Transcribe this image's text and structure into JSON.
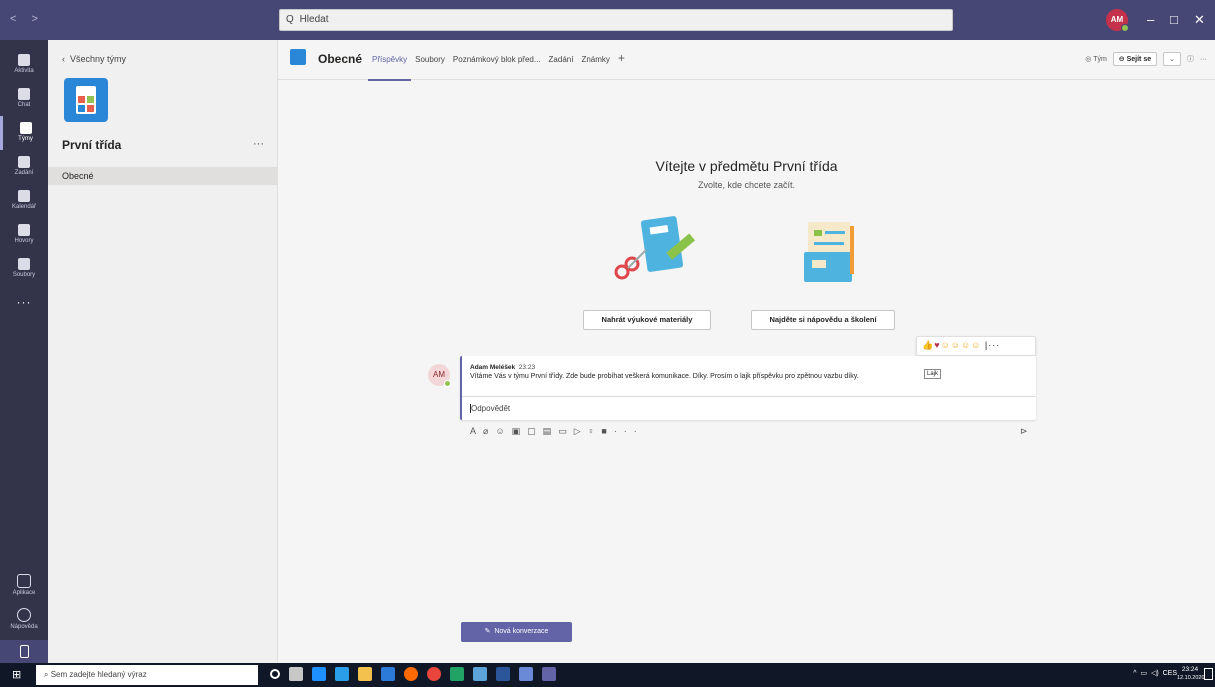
{
  "titlebar": {
    "search_text": "Hledat",
    "user_initials": "AM",
    "minimize": "–",
    "maximize": "□",
    "close": "✕"
  },
  "rail": {
    "items": [
      {
        "label": "Aktivita"
      },
      {
        "label": "Chat"
      },
      {
        "label": "Týmy"
      },
      {
        "label": "Zadání"
      },
      {
        "label": "Kalendář"
      },
      {
        "label": "Hovory"
      },
      {
        "label": "Soubory"
      }
    ],
    "more": "···",
    "apps_label": "Aplikace",
    "help_label": "Nápověda"
  },
  "panel": {
    "back_label": "Všechny týmy",
    "team_name": "První třída",
    "more": "···",
    "channels": [
      "Obecné"
    ]
  },
  "header": {
    "channel_title": "Obecné",
    "tabs": [
      {
        "label": "Příspěvky"
      },
      {
        "label": "Soubory"
      },
      {
        "label": "Poznámkový blok před..."
      },
      {
        "label": "Zadání"
      },
      {
        "label": "Známky"
      }
    ],
    "add_tab": "+",
    "team_label": "Tým",
    "meet_label": "Sejít se",
    "info": "ⓘ",
    "more": "···"
  },
  "welcome": {
    "title": "Vítejte v předmětu První třída",
    "subtitle": "Zvolte, kde chcete začít.",
    "action_upload": "Nahrát výukové materiály",
    "action_help": "Najděte si nápovědu a školení"
  },
  "post": {
    "avatar_initials": "AM",
    "author": "Adam Meléšek",
    "time": "23:23",
    "body": "Vítáme Vás v týmu První třídy. Zde bude probíhat veškerá komunikace. Díky. Prosím o lajk příspěvku pro zpětnou vazbu díky.",
    "tooltip": "Lajk",
    "reply_label": "Odpovědět"
  },
  "new_conversation": "Nová konverzace",
  "taskbar": {
    "search_placeholder": "Sem zadejte hledaný výraz",
    "language": "CES",
    "time": "23:24",
    "date": "12.10.2020"
  }
}
